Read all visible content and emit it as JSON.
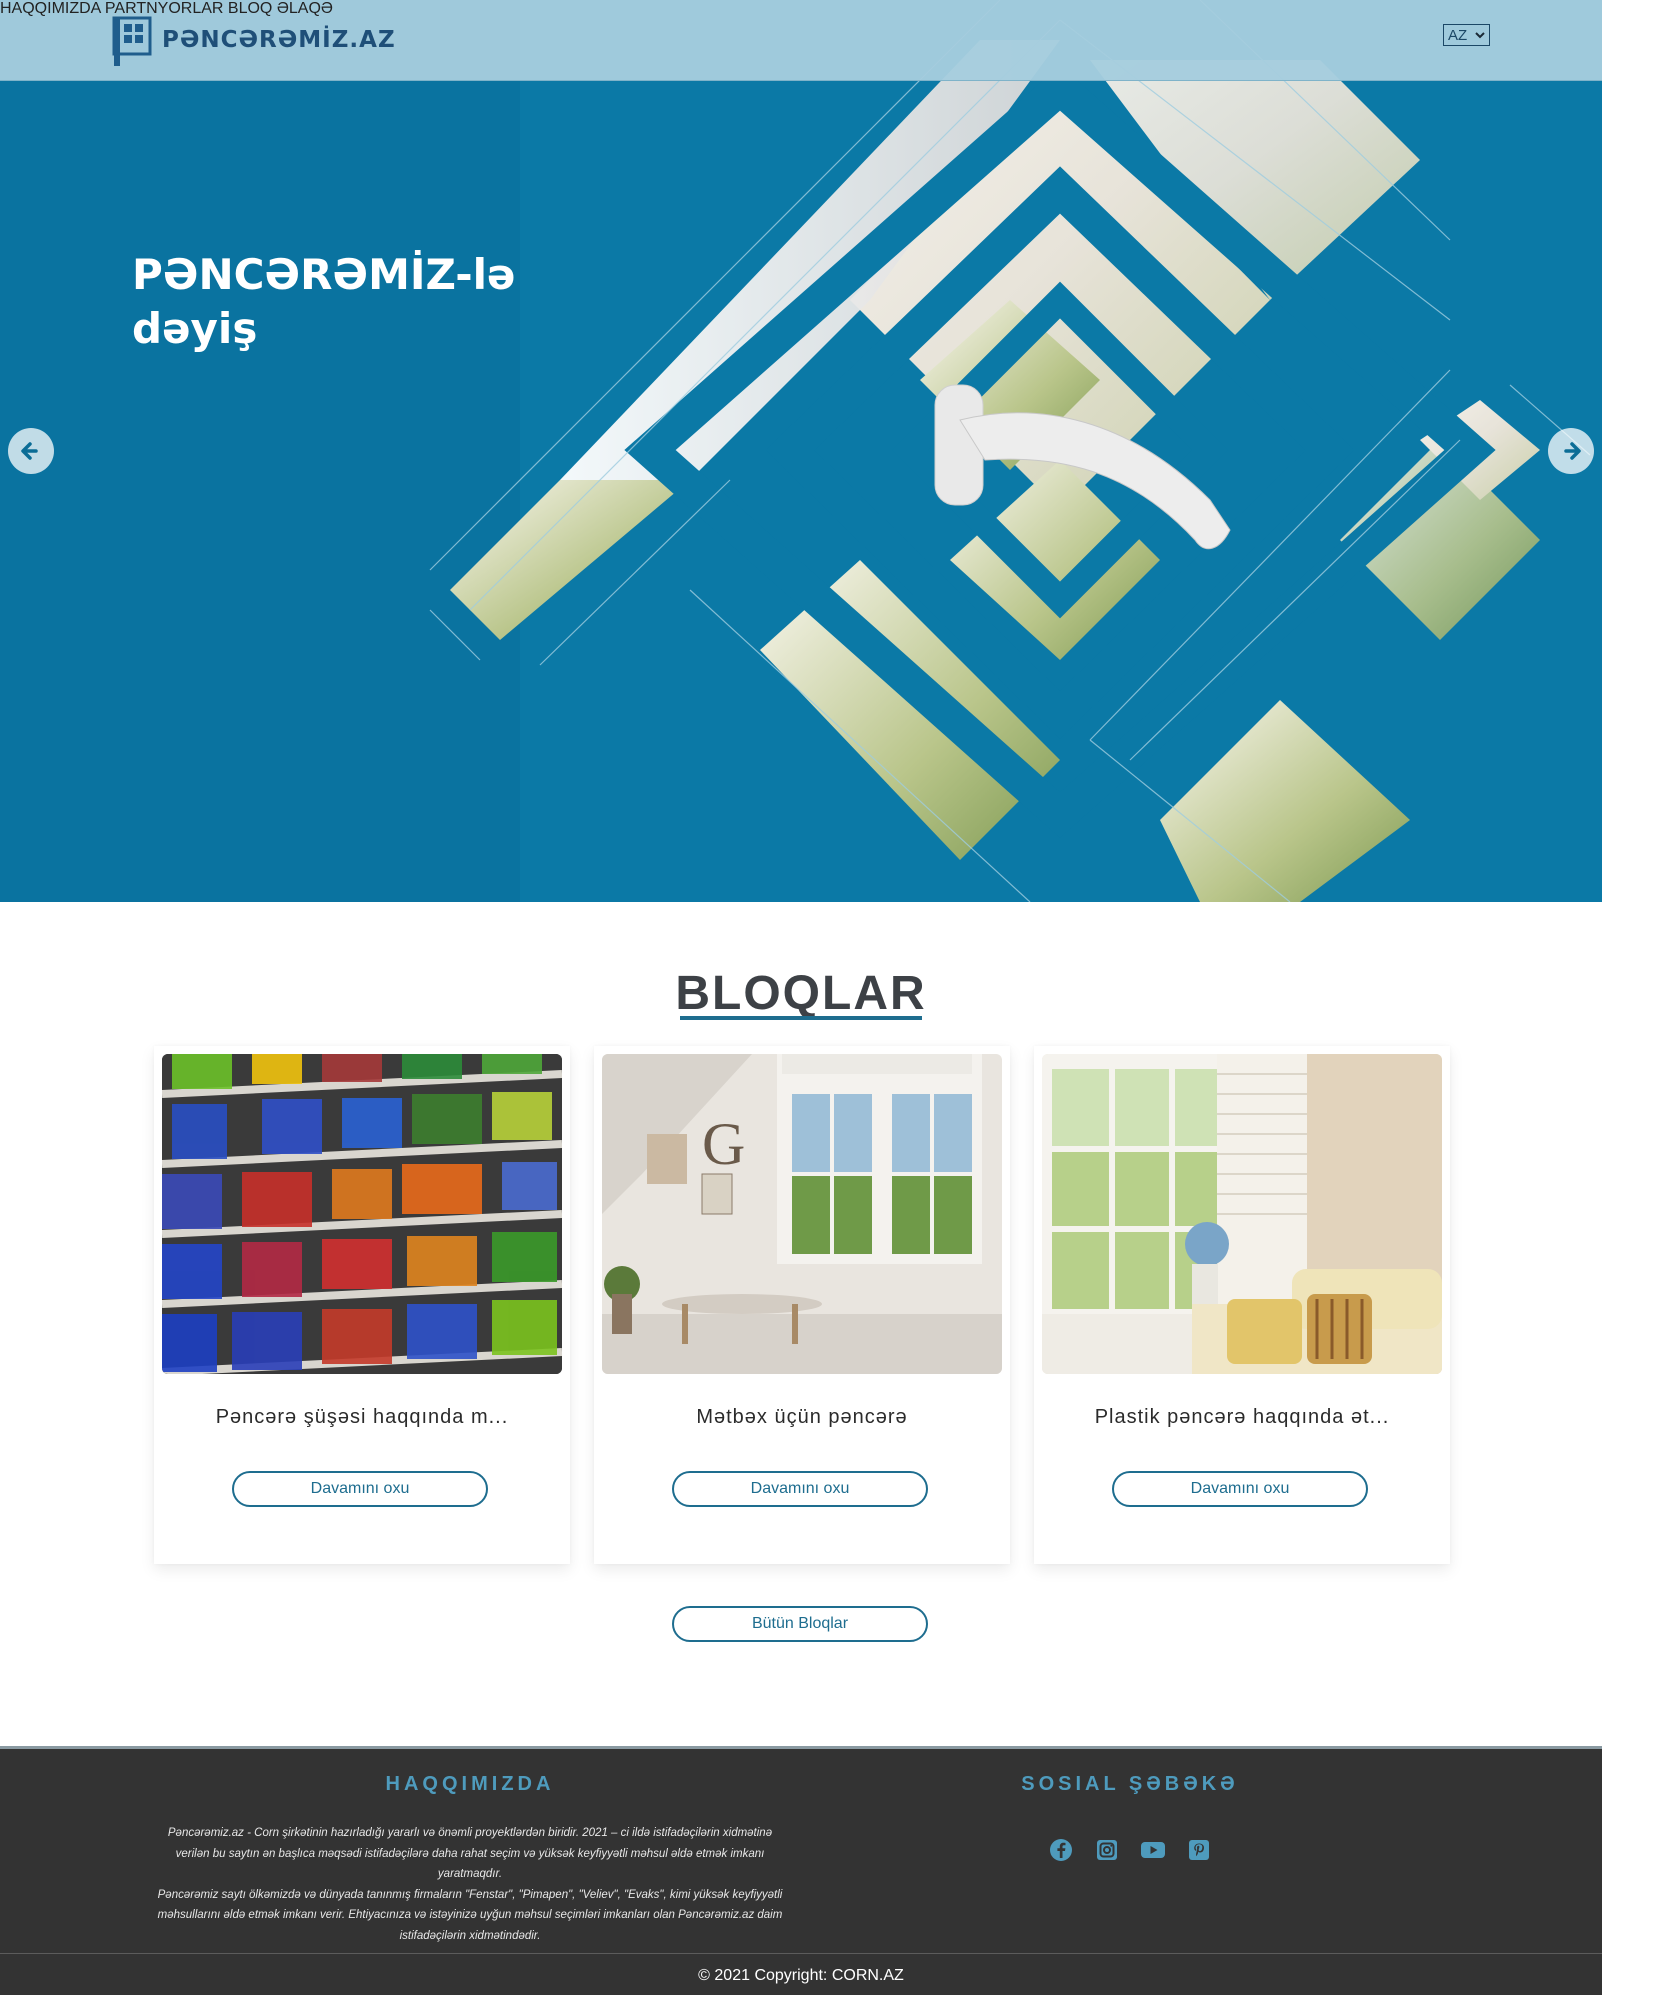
{
  "header": {
    "logo_text": "PƏNCƏRƏMİZ.AZ",
    "nav": [
      "HAQQIMIZDA",
      "PARTNYORLAR",
      "BLOQ",
      "ƏLAQƏ"
    ],
    "language": "AZ"
  },
  "hero": {
    "title_line1": "PƏNCƏRƏMİZ-lə",
    "title_line2": "dəyiş",
    "prev_icon": "arrow-left-icon",
    "next_icon": "arrow-right-icon"
  },
  "blog": {
    "section_title": "BLOQLAR",
    "cards": [
      {
        "title": "Pəncərə şüşəsi haqqında m...",
        "button": "Davamını oxu",
        "image": "colorful-glass-balconies"
      },
      {
        "title": "Mətbəx üçün pəncərə",
        "button": "Davamını oxu",
        "image": "white-room-window"
      },
      {
        "title": "Plastik pəncərə haqqında ət...",
        "button": "Davamını oxu",
        "image": "window-with-sofa"
      }
    ],
    "all_button": "Bütün Bloqlar"
  },
  "footer": {
    "about_heading": "HAQQIMIZDA",
    "about_p1": "Pəncərəmiz.az - Corn şirkətinin hazırladığı yararlı və önəmli proyektlərdən biridir. 2021 – ci ildə istifadəçilərin xidmətinə verilən bu saytın ən başlıca məqsədi istifadəçilərə daha rahat seçim və yüksək keyfiyyətli məhsul əldə etmək imkanı yaratmaqdır.",
    "about_p2": "Pəncərəmiz saytı ölkəmizdə və dünyada tanınmış firmaların \"Fenstar\", \"Pimapen\", \"Veliev\", \"Evaks\",  kimi yüksək keyfiyyətli məhsullarını əldə etmək imkanı verir. Ehtiyacınıza və istəyinizə uyğun məhsul seçimləri imkanları olan Pəncərəmiz.az daim istifadəçilərin xidmətindədir.",
    "social_heading": "SOSIAL ŞƏBƏKƏ",
    "social_icons": [
      "facebook-icon",
      "instagram-icon",
      "youtube-icon",
      "pinterest-icon"
    ],
    "copyright": "© 2021 Copyright: CORN.AZ"
  },
  "colors": {
    "hero_bg": "#0b79a6",
    "header_bg": "#a6cdde",
    "accent": "#1e6d8f",
    "footer_bg": "#333333",
    "footer_heading": "#4e9bbd"
  }
}
